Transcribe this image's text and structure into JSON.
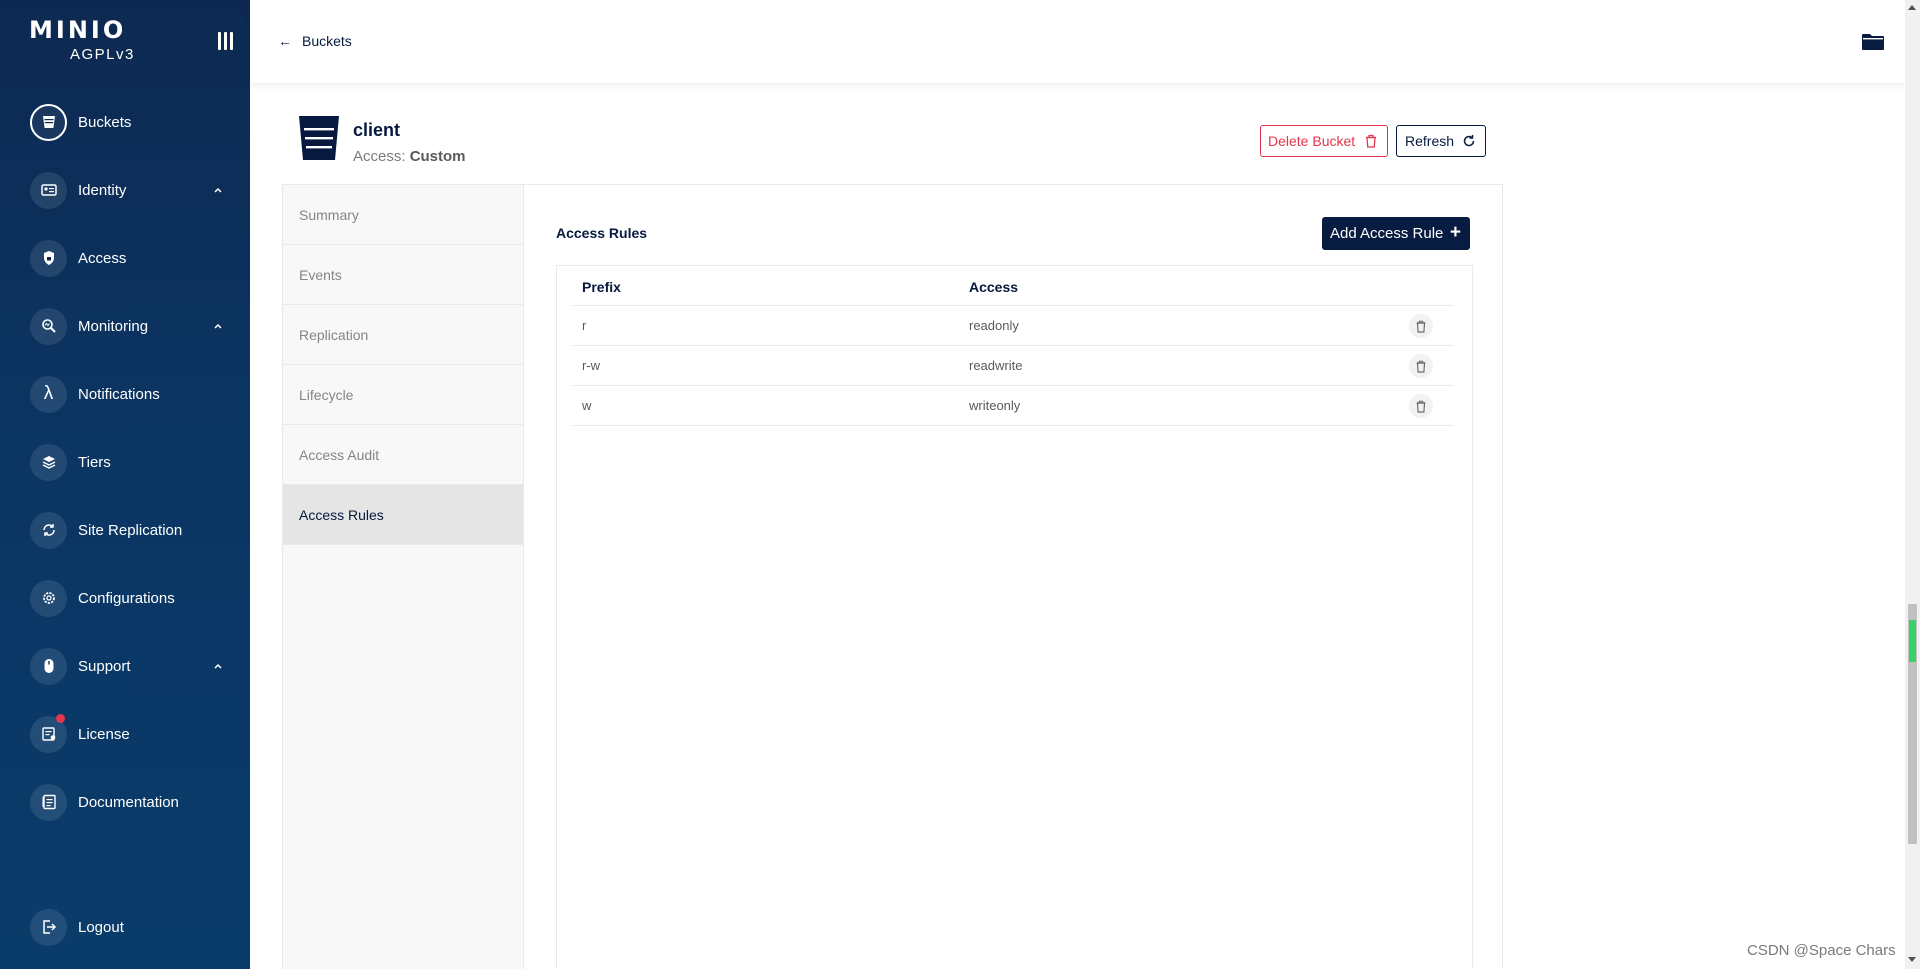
{
  "sidebar": {
    "logo_text": "MINIO",
    "logo_sub": "AGPLv3",
    "items": [
      {
        "label": "Buckets",
        "icon": "bucket-icon",
        "active": true
      },
      {
        "label": "Identity",
        "icon": "identity-card-icon",
        "expandable": true
      },
      {
        "label": "Access",
        "icon": "lock-shield-icon"
      },
      {
        "label": "Monitoring",
        "icon": "magnifier-chart-icon",
        "expandable": true
      },
      {
        "label": "Notifications",
        "icon": "lambda-icon"
      },
      {
        "label": "Tiers",
        "icon": "layers-icon"
      },
      {
        "label": "Site Replication",
        "icon": "sync-icon"
      },
      {
        "label": "Configurations",
        "icon": "gear-icon"
      },
      {
        "label": "Support",
        "icon": "mouse-icon",
        "expandable": true
      },
      {
        "label": "License",
        "icon": "license-icon",
        "badge": true
      },
      {
        "label": "Documentation",
        "icon": "document-icon"
      },
      {
        "label": "Logout",
        "icon": "logout-icon"
      }
    ]
  },
  "topbar": {
    "back_label": "Buckets",
    "back_arrow": "←"
  },
  "bucket": {
    "name": "client",
    "access_label": "Access:",
    "access_value": "Custom"
  },
  "actions": {
    "delete_label": "Delete Bucket",
    "refresh_label": "Refresh"
  },
  "tabs": [
    {
      "label": "Summary"
    },
    {
      "label": "Events"
    },
    {
      "label": "Replication"
    },
    {
      "label": "Lifecycle"
    },
    {
      "label": "Access Audit"
    },
    {
      "label": "Access Rules",
      "active": true
    }
  ],
  "access_rules": {
    "title": "Access Rules",
    "add_label": "Add Access Rule",
    "add_icon": "+",
    "columns": [
      "Prefix",
      "Access"
    ],
    "rows": [
      {
        "prefix": "r",
        "access": "readonly"
      },
      {
        "prefix": "r-w",
        "access": "readwrite"
      },
      {
        "prefix": "w",
        "access": "writeonly"
      }
    ]
  },
  "watermark": "CSDN @Space Chars",
  "colors": {
    "sidebar_top": "#0d2951",
    "sidebar_bottom": "#0a3c6b",
    "primary": "#081c42",
    "danger": "#e5374d",
    "active_tab": "#e5e5e5"
  }
}
